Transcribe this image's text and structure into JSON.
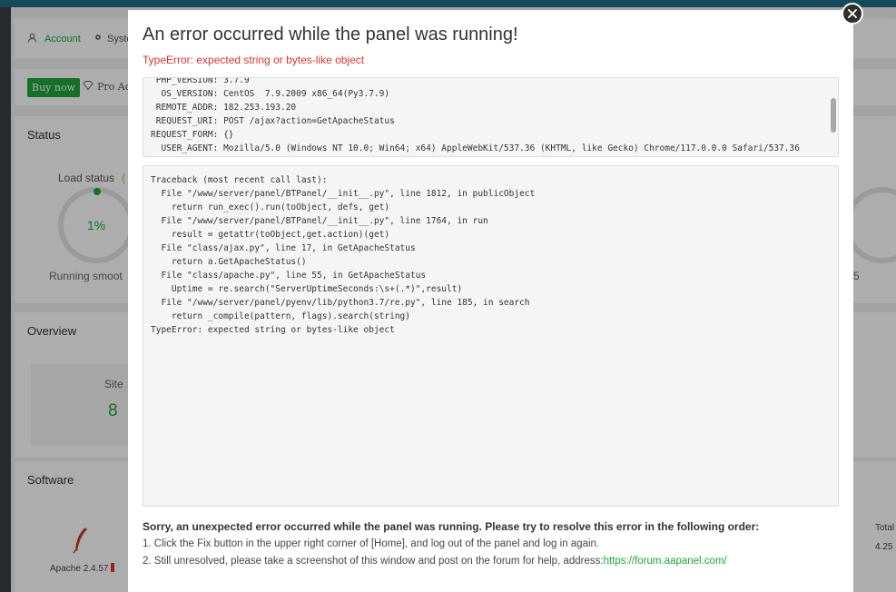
{
  "background": {
    "nav": {
      "account": "Account",
      "system": "Syste"
    },
    "buy_now": "Buy now",
    "pro_adv": "Pro Adv",
    "status_title": "Status",
    "load_status": "Load status",
    "load_value": "1%",
    "load_caption": "Running smoot",
    "right_cut_text": "5",
    "overview_title": "Overview",
    "site_label": "Site",
    "site_value": "8",
    "software_title": "Software",
    "apache": "Apache 2.4.57",
    "total_label": "Total",
    "total_value": "4.25",
    "colors": {
      "accent": "#20a53a",
      "topbar": "#1c6f86"
    },
    "icons": {
      "account": "user-icon",
      "system": "gear-icon",
      "pro": "diamond-icon",
      "apache": "feather-icon"
    }
  },
  "modal": {
    "title": "An error occurred while the panel was running!",
    "subtitle": "TypeError: expected string or bytes-like object",
    "env_lines": [
      " PHP_VERSION: 3.7.9",
      "  OS_VERSION: CentOS  7.9.2009 x86_64(Py3.7.9)",
      " REMOTE_ADDR: 182.253.193.20",
      " REQUEST_URI: POST /ajax?action=GetApacheStatus",
      "REQUEST_FORM: {}",
      "  USER_AGENT: Mozilla/5.0 (Windows NT 10.0; Win64; x64) AppleWebKit/537.36 (KHTML, like Gecko) Chrome/117.0.0.0 Safari/537.36"
    ],
    "traceback_lines": [
      "Traceback (most recent call last):",
      "  File \"/www/server/panel/BTPanel/__init__.py\", line 1812, in publicObject",
      "    return run_exec().run(toObject, defs, get)",
      "  File \"/www/server/panel/BTPanel/__init__.py\", line 1764, in run",
      "    result = getattr(toObject,get.action)(get)",
      "  File \"class/ajax.py\", line 17, in GetApacheStatus",
      "    return a.GetApacheStatus()",
      "  File \"class/apache.py\", line 55, in GetApacheStatus",
      "    Uptime = re.search(\"ServerUptimeSeconds:\\s+(.*)\",result)",
      "  File \"/www/server/panel/pyenv/lib/python3.7/re.py\", line 185, in search",
      "    return _compile(pattern, flags).search(string)",
      "TypeError: expected string or bytes-like object"
    ],
    "help_title": "Sorry, an unexpected error occurred while the panel was running. Please try to resolve this error in the following order:",
    "help_step1": "1. Click the Fix button in the upper right corner of [Home], and log out of the panel and log in again.",
    "help_step2_prefix": "2. Still unresolved, please take a screenshot of this window and post on the forum for help, address:",
    "help_link": "https://forum.aapanel.com/",
    "close_icon": "close-icon",
    "colors": {
      "error": "#d9362f",
      "link": "#20a53a"
    }
  }
}
